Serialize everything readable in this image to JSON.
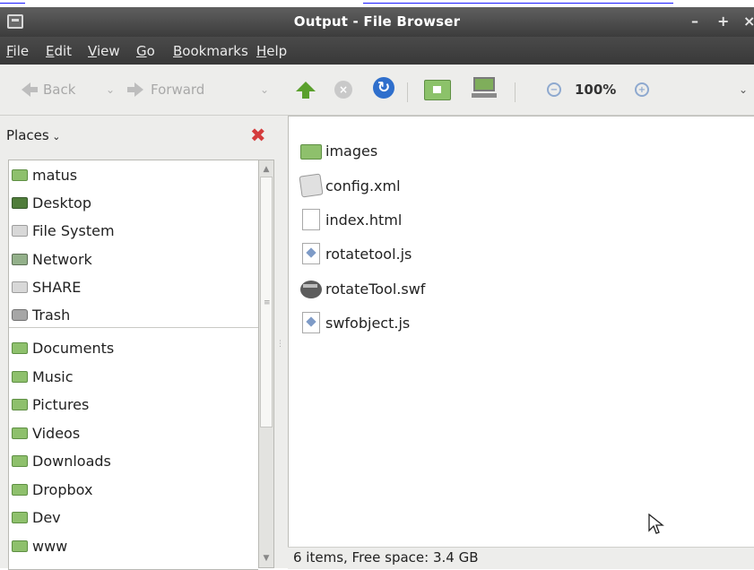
{
  "window": {
    "title": "Output - File Browser",
    "controls": [
      "–",
      "+",
      "×"
    ]
  },
  "menu": [
    {
      "label": "File"
    },
    {
      "label": "Edit"
    },
    {
      "label": "View"
    },
    {
      "label": "Go"
    },
    {
      "label": "Bookmarks"
    },
    {
      "label": "Help"
    }
  ],
  "toolbar": {
    "back_label": "Back",
    "forward_label": "Forward",
    "zoom": "100%"
  },
  "sidebar": {
    "header": "Places",
    "places": [
      {
        "label": "matus",
        "icon": "home-folder-icon"
      },
      {
        "label": "Desktop",
        "icon": "desktop-icon"
      },
      {
        "label": "File System",
        "icon": "drive-icon"
      },
      {
        "label": "Network",
        "icon": "network-icon"
      },
      {
        "label": "SHARE",
        "icon": "drive-icon"
      },
      {
        "label": "Trash",
        "icon": "trash-icon"
      }
    ],
    "bookmarks": [
      {
        "label": "Documents",
        "icon": "folder-icon"
      },
      {
        "label": "Music",
        "icon": "folder-icon"
      },
      {
        "label": "Pictures",
        "icon": "folder-icon"
      },
      {
        "label": "Videos",
        "icon": "folder-icon"
      },
      {
        "label": "Downloads",
        "icon": "folder-icon"
      },
      {
        "label": "Dropbox",
        "icon": "folder-icon"
      },
      {
        "label": "Dev",
        "icon": "folder-icon"
      },
      {
        "label": "www",
        "icon": "folder-icon"
      }
    ]
  },
  "files": [
    {
      "name": "images",
      "icon": "folder-icon"
    },
    {
      "name": "config.xml",
      "icon": "xml-file-icon"
    },
    {
      "name": "index.html",
      "icon": "html-file-icon"
    },
    {
      "name": "rotatetool.js",
      "icon": "js-file-icon"
    },
    {
      "name": "rotateTool.swf",
      "icon": "swf-file-icon"
    },
    {
      "name": "swfobject.js",
      "icon": "js-file-icon"
    }
  ],
  "status": "6 items, Free space: 3.4 GB",
  "colors": {
    "titlebar": "#4b4b4b",
    "folder": "#8ec06c",
    "accent_blue": "#2f6fcc"
  }
}
